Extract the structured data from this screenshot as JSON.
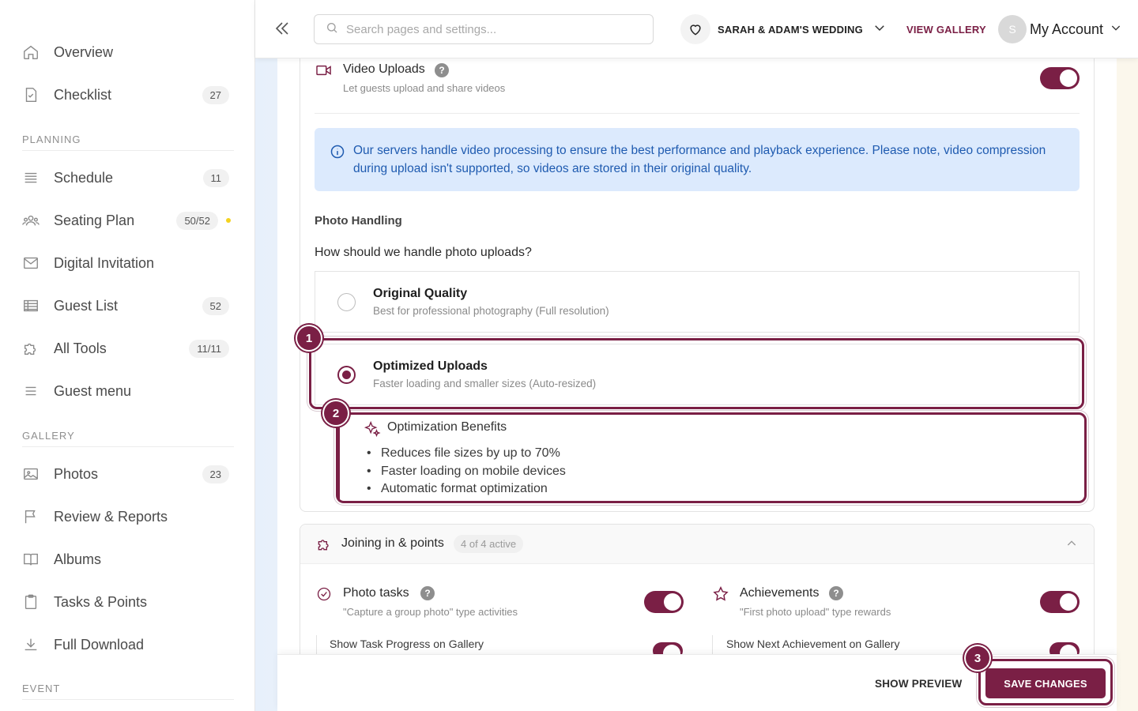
{
  "sidebar": {
    "items_top": [
      {
        "label": "Overview",
        "icon": "home-icon"
      },
      {
        "label": "Checklist",
        "icon": "checklist-icon",
        "count": "27"
      }
    ],
    "section_planning": "PLANNING",
    "planning_items": [
      {
        "label": "Schedule",
        "icon": "schedule-icon",
        "count": "11"
      },
      {
        "label": "Seating Plan",
        "icon": "people-icon",
        "count": "50/52",
        "dot_color": "#f4d21f"
      },
      {
        "label": "Digital Invitation",
        "icon": "mail-icon"
      },
      {
        "label": "Guest List",
        "icon": "list-icon",
        "count": "52"
      },
      {
        "label": "All Tools",
        "icon": "puzzle-icon",
        "count": "11/11"
      },
      {
        "label": "Guest menu",
        "icon": "menu-icon"
      }
    ],
    "section_gallery": "GALLERY",
    "gallery_items": [
      {
        "label": "Photos",
        "icon": "image-icon",
        "count": "23"
      },
      {
        "label": "Review & Reports",
        "icon": "flag-icon"
      },
      {
        "label": "Albums",
        "icon": "book-icon"
      },
      {
        "label": "Tasks & Points",
        "icon": "clipboard-icon"
      },
      {
        "label": "Full Download",
        "icon": "download-icon"
      }
    ],
    "section_event": "EVENT"
  },
  "topbar": {
    "search_placeholder": "Search pages and settings...",
    "wedding_name": "SARAH & ADAM'S WEDDING",
    "view_gallery": "VIEW GALLERY",
    "avatar_initial": "S",
    "account_label": "My Account"
  },
  "video": {
    "title": "Video Uploads",
    "help": "?",
    "subtitle": "Let guests upload and share videos",
    "enabled": true,
    "info": "Our servers handle video processing to ensure the best performance and playback experience. Please note, video compression during upload isn't supported, so videos are stored in their original quality."
  },
  "photo_handling": {
    "heading": "Photo Handling",
    "question": "How should we handle photo uploads?",
    "options": [
      {
        "title": "Original Quality",
        "subtitle": "Best for professional photography (Full resolution)",
        "selected": false
      },
      {
        "title": "Optimized Uploads",
        "subtitle": "Faster loading and smaller sizes (Auto-resized)",
        "selected": true
      }
    ],
    "benefits_title": "Optimization Benefits",
    "benefits": [
      "Reduces file sizes by up to 70%",
      "Faster loading on mobile devices",
      "Automatic format optimization"
    ]
  },
  "joining": {
    "title": "Joining in & points",
    "status": "4 of 4 active",
    "photo_tasks": {
      "title": "Photo tasks",
      "help": "?",
      "subtitle": "\"Capture a group photo\" type activities",
      "enabled": true
    },
    "achievements": {
      "title": "Achievements",
      "help": "?",
      "subtitle": "\"First photo upload\" type rewards",
      "enabled": true
    },
    "show_task_progress": "Show Task Progress on Gallery",
    "show_next_achievement": "Show Next Achievement on Gallery"
  },
  "footer": {
    "show_preview": "SHOW PREVIEW",
    "save_changes": "SAVE CHANGES"
  },
  "annotations": [
    "1",
    "2",
    "3"
  ],
  "colors": {
    "accent": "#7a1f45",
    "info_bg": "#dceafd",
    "info_text": "#1f5bb0"
  }
}
